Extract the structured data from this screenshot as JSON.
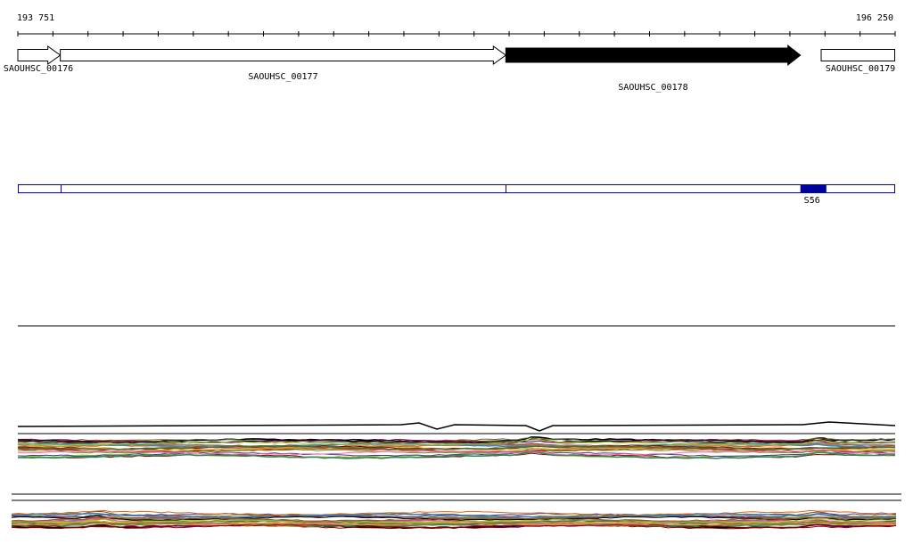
{
  "coords": {
    "start_label": "193 751",
    "end_label": "196 250",
    "start": 193751,
    "end": 196250
  },
  "genes": [
    {
      "label": "SAOUHSC_00176",
      "start": 193751,
      "end": 193872,
      "strand": "+",
      "highlight": false,
      "label_row": 1
    },
    {
      "label": "SAOUHSC_00177",
      "start": 193872,
      "end": 195141,
      "strand": "+",
      "highlight": false,
      "label_row": 2
    },
    {
      "label": "SAOUHSC_00178",
      "start": 195141,
      "end": 195980,
      "strand": "+",
      "highlight": true,
      "label_row": 3
    },
    {
      "label": "SAOUHSC_00179",
      "start": 196038,
      "end": 196250,
      "strand": "+",
      "highlight": false,
      "label_row": 1,
      "truncated": true
    }
  ],
  "regions": {
    "boundaries": [
      193872,
      195141
    ],
    "features": [
      {
        "label": "S56",
        "start": 195980,
        "end": 196054
      }
    ]
  },
  "colors": {
    "axis": "#000000",
    "gene_highlight": "#000000",
    "gene_normal": "#ffffff",
    "region_outline": "#0000cc",
    "feature_fill": "#00009c"
  },
  "track_palette": [
    "#000000",
    "#8b0000",
    "#556b2f",
    "#9acd32",
    "#cd853f",
    "#a0522d",
    "#8b4513",
    "#800080",
    "#b22222",
    "#6b8e23",
    "#bdb76b",
    "#483d8b",
    "#2e8b57",
    "#808080",
    "#d2691e",
    "#ff69b4",
    "#4682b4",
    "#daa520"
  ]
}
